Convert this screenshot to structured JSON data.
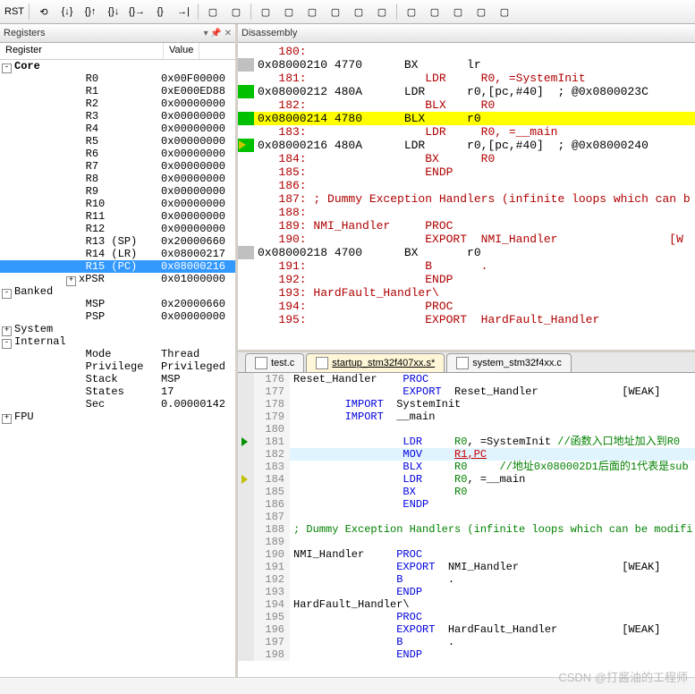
{
  "toolbar": [
    "RST",
    "⟲",
    "{↓}",
    "{}↑",
    "{}↓",
    "{}→",
    "{}",
    "→|",
    "▢",
    "▢",
    "▢",
    "▢",
    "▢",
    "▢",
    "▢",
    "▢",
    "▢",
    "▢",
    "▢",
    "▢",
    "▢"
  ],
  "panes": {
    "registers": "Registers",
    "disassembly": "Disassembly"
  },
  "reg_header": {
    "c1": "Register",
    "c2": "Value"
  },
  "registers": [
    {
      "exp": "-",
      "ind": 0,
      "name": "Core",
      "val": "",
      "bold": true
    },
    {
      "ind": 2,
      "name": "R0",
      "val": "0x00F00000"
    },
    {
      "ind": 2,
      "name": "R1",
      "val": "0xE000ED88"
    },
    {
      "ind": 2,
      "name": "R2",
      "val": "0x00000000"
    },
    {
      "ind": 2,
      "name": "R3",
      "val": "0x00000000"
    },
    {
      "ind": 2,
      "name": "R4",
      "val": "0x00000000"
    },
    {
      "ind": 2,
      "name": "R5",
      "val": "0x00000000"
    },
    {
      "ind": 2,
      "name": "R6",
      "val": "0x00000000"
    },
    {
      "ind": 2,
      "name": "R7",
      "val": "0x00000000"
    },
    {
      "ind": 2,
      "name": "R8",
      "val": "0x00000000"
    },
    {
      "ind": 2,
      "name": "R9",
      "val": "0x00000000"
    },
    {
      "ind": 2,
      "name": "R10",
      "val": "0x00000000"
    },
    {
      "ind": 2,
      "name": "R11",
      "val": "0x00000000"
    },
    {
      "ind": 2,
      "name": "R12",
      "val": "0x00000000"
    },
    {
      "ind": 2,
      "name": "R13 (SP)",
      "val": "0x20000660"
    },
    {
      "ind": 2,
      "name": "R14 (LR)",
      "val": "0x08000217"
    },
    {
      "ind": 2,
      "name": "R15 (PC)",
      "val": "0x08000216",
      "sel": true
    },
    {
      "exp": "+",
      "ind": 2,
      "name": "xPSR",
      "val": "0x01000000"
    },
    {
      "exp": "-",
      "ind": 0,
      "name": "Banked",
      "val": ""
    },
    {
      "ind": 2,
      "name": "MSP",
      "val": "0x20000660"
    },
    {
      "ind": 2,
      "name": "PSP",
      "val": "0x00000000"
    },
    {
      "exp": "+",
      "ind": 0,
      "name": "System",
      "val": ""
    },
    {
      "exp": "-",
      "ind": 0,
      "name": "Internal",
      "val": ""
    },
    {
      "ind": 2,
      "name": "Mode",
      "val": "Thread"
    },
    {
      "ind": 2,
      "name": "Privilege",
      "val": "Privileged"
    },
    {
      "ind": 2,
      "name": "Stack",
      "val": "MSP"
    },
    {
      "ind": 2,
      "name": "States",
      "val": "17"
    },
    {
      "ind": 2,
      "name": "Sec",
      "val": "0.00000142"
    },
    {
      "exp": "+",
      "ind": 0,
      "name": "FPU",
      "val": ""
    }
  ],
  "disasm": [
    {
      "g": "",
      "t": "   180:",
      "cls": "red"
    },
    {
      "g": "grey",
      "t": "0x08000210 4770      BX       lr"
    },
    {
      "g": "",
      "t": "   181:                 LDR     R0, =SystemInit",
      "cls": "red"
    },
    {
      "g": "green",
      "t": "0x08000212 480A      LDR      r0,[pc,#40]  ; @0x0800023C"
    },
    {
      "g": "",
      "t": "   182:                 BLX     R0",
      "cls": "red"
    },
    {
      "g": "green",
      "t": "0x08000214 4780      BLX      r0",
      "hl": true
    },
    {
      "g": "",
      "t": "   183:                 LDR     R0, =__main",
      "cls": "red"
    },
    {
      "g": "green",
      "t": "0x08000216 480A      LDR      r0,[pc,#40]  ; @0x08000240",
      "cur": true
    },
    {
      "g": "",
      "t": "   184:                 BX      R0",
      "cls": "red"
    },
    {
      "g": "",
      "t": "   185:                 ENDP",
      "cls": "red"
    },
    {
      "g": "",
      "t": "   186:",
      "cls": "red"
    },
    {
      "g": "",
      "t": "   187: ; Dummy Exception Handlers (infinite loops which can b",
      "cls": "red"
    },
    {
      "g": "",
      "t": "   188:",
      "cls": "red"
    },
    {
      "g": "",
      "t": "   189: NMI_Handler     PROC",
      "cls": "red"
    },
    {
      "g": "",
      "t": "   190:                 EXPORT  NMI_Handler                [W",
      "cls": "red"
    },
    {
      "g": "grey",
      "t": "0x08000218 4700      BX       r0"
    },
    {
      "g": "",
      "t": "   191:                 B       .",
      "cls": "red"
    },
    {
      "g": "",
      "t": "   192:                 ENDP",
      "cls": "red"
    },
    {
      "g": "",
      "t": "   193: HardFault_Handler\\",
      "cls": "red"
    },
    {
      "g": "",
      "t": "   194:                 PROC",
      "cls": "red"
    },
    {
      "g": "",
      "t": "   195:                 EXPORT  HardFault_Handler",
      "cls": "red"
    }
  ],
  "tabs": [
    {
      "label": "test.c",
      "active": false
    },
    {
      "label": "startup_stm32f407xx.s*",
      "active": true
    },
    {
      "label": "system_stm32f4xx.c",
      "active": false
    }
  ],
  "editor": [
    {
      "n": 176,
      "t": "Reset_Handler    PROC",
      "k": [
        "PROC"
      ]
    },
    {
      "n": 177,
      "t": "                 EXPORT  Reset_Handler             [WEAK]",
      "k": [
        "EXPORT"
      ]
    },
    {
      "n": 178,
      "t": "        IMPORT  SystemInit",
      "k": [
        "IMPORT"
      ]
    },
    {
      "n": 179,
      "t": "        IMPORT  __main",
      "k": [
        "IMPORT"
      ]
    },
    {
      "n": 180,
      "t": ""
    },
    {
      "n": 181,
      "t": "                 LDR     R0, =SystemInit //函数入口地址加入到R0",
      "k": [
        "LDR"
      ],
      "c": "//函数入口地址加入到R0",
      "tri": "g"
    },
    {
      "n": 182,
      "t": "                 MOV     R1,PC",
      "k": [
        "MOV"
      ],
      "hl": true,
      "red": "R1,PC"
    },
    {
      "n": 183,
      "t": "                 BLX     R0     //地址0x080002D1后面的1代表是sub",
      "k": [
        "BLX"
      ],
      "c": "//地址0x080002D1后面的1代表是sub"
    },
    {
      "n": 184,
      "t": "                 LDR     R0, =__main",
      "k": [
        "LDR"
      ],
      "tri": "y"
    },
    {
      "n": 185,
      "t": "                 BX      R0",
      "k": [
        "BX"
      ]
    },
    {
      "n": 186,
      "t": "                 ENDP",
      "k": [
        "ENDP"
      ]
    },
    {
      "n": 187,
      "t": ""
    },
    {
      "n": 188,
      "t": "; Dummy Exception Handlers (infinite loops which can be modifi",
      "c": "; Dummy Exception Handlers (infinite loops which can be modifi"
    },
    {
      "n": 189,
      "t": ""
    },
    {
      "n": 190,
      "t": "NMI_Handler     PROC",
      "k": [
        "PROC"
      ]
    },
    {
      "n": 191,
      "t": "                EXPORT  NMI_Handler                [WEAK]",
      "k": [
        "EXPORT"
      ]
    },
    {
      "n": 192,
      "t": "                B       .",
      "k": [
        "B"
      ]
    },
    {
      "n": 193,
      "t": "                ENDP",
      "k": [
        "ENDP"
      ]
    },
    {
      "n": 194,
      "t": "HardFault_Handler\\"
    },
    {
      "n": 195,
      "t": "                PROC",
      "k": [
        "PROC"
      ]
    },
    {
      "n": 196,
      "t": "                EXPORT  HardFault_Handler          [WEAK]",
      "k": [
        "EXPORT"
      ]
    },
    {
      "n": 197,
      "t": "                B       .",
      "k": [
        "B"
      ]
    },
    {
      "n": 198,
      "t": "                ENDP",
      "k": [
        "ENDP"
      ]
    }
  ],
  "watermark": "CSDN @打酱油的工程师",
  "bottom": {
    "left": "",
    "right": ""
  }
}
